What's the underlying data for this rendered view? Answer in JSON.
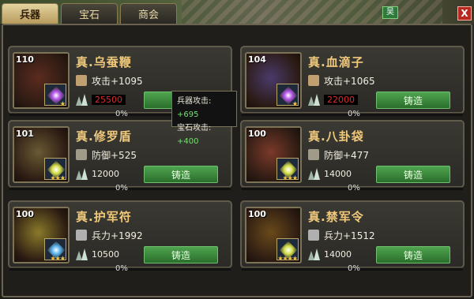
{
  "tabs": [
    {
      "label": "兵器",
      "active": true
    },
    {
      "label": "宝石",
      "active": false
    },
    {
      "label": "商会",
      "active": false
    }
  ],
  "corner_tag": "吴",
  "close_label": "X",
  "colors": {
    "name": "#f1c97a",
    "price_red": "#e02a2a",
    "price_white": "#f2eee0",
    "button": "#3c8a3e",
    "tooltip_value": "#6fe06f"
  },
  "items": [
    {
      "level": "110",
      "name": "真.乌蚕鞭",
      "stat_icon": "sword-icon",
      "stat": "攻击+1095",
      "price": "25500",
      "price_affordable": false,
      "forge_label": "铸造",
      "progress": 0,
      "progress_label": "0%",
      "art_color": "#5b2b1f",
      "gem_color": "#b154e6",
      "gem_icon": "purple-gem-icon",
      "stars": 1
    },
    {
      "level": "104",
      "name": "真.血滴子",
      "stat_icon": "sword-icon",
      "stat": "攻击+1065",
      "price": "22000",
      "price_affordable": false,
      "forge_label": "铸造",
      "progress": 0,
      "progress_label": "0%",
      "art_color": "#4a3a6a",
      "gem_color": "#b154e6",
      "gem_icon": "purple-gem-icon",
      "stars": 1
    },
    {
      "level": "101",
      "name": "真.修罗盾",
      "stat_icon": "shield-icon",
      "stat": "防御+525",
      "price": "12000",
      "price_affordable": true,
      "forge_label": "铸造",
      "progress": 0,
      "progress_label": "0%",
      "art_color": "#6a5a34",
      "gem_color": "#d6e04a",
      "gem_icon": "yellow-gem-icon",
      "stars": 3
    },
    {
      "level": "100",
      "name": "真.八卦袋",
      "stat_icon": "shield-icon",
      "stat": "防御+477",
      "price": "14000",
      "price_affordable": true,
      "forge_label": "铸造",
      "progress": 0,
      "progress_label": "0%",
      "art_color": "#7a3a2a",
      "gem_color": "#d6e04a",
      "gem_icon": "yellow-gem-icon",
      "stars": 3
    },
    {
      "level": "100",
      "name": "真.护军符",
      "stat_icon": "soldier-icon",
      "stat": "兵力+1992",
      "price": "10500",
      "price_affordable": true,
      "forge_label": "铸造",
      "progress": 0,
      "progress_label": "0%",
      "art_color": "#8a7a2a",
      "gem_color": "#5ab4f0",
      "gem_icon": "blue-gem-icon",
      "stars": 3
    },
    {
      "level": "100",
      "name": "真.禁军令",
      "stat_icon": "soldier-icon",
      "stat": "兵力+1512",
      "price": "14000",
      "price_affordable": true,
      "forge_label": "铸造",
      "progress": 0,
      "progress_label": "0%",
      "art_color": "#6a4a1a",
      "gem_color": "#d6e04a",
      "gem_icon": "yellow-gem-icon",
      "stars": 4
    }
  ],
  "tooltip": {
    "weapon_attack_label": "兵器攻击:",
    "weapon_attack_value": "+695",
    "gem_attack_label": "宝石攻击:",
    "gem_attack_value": "+400"
  }
}
